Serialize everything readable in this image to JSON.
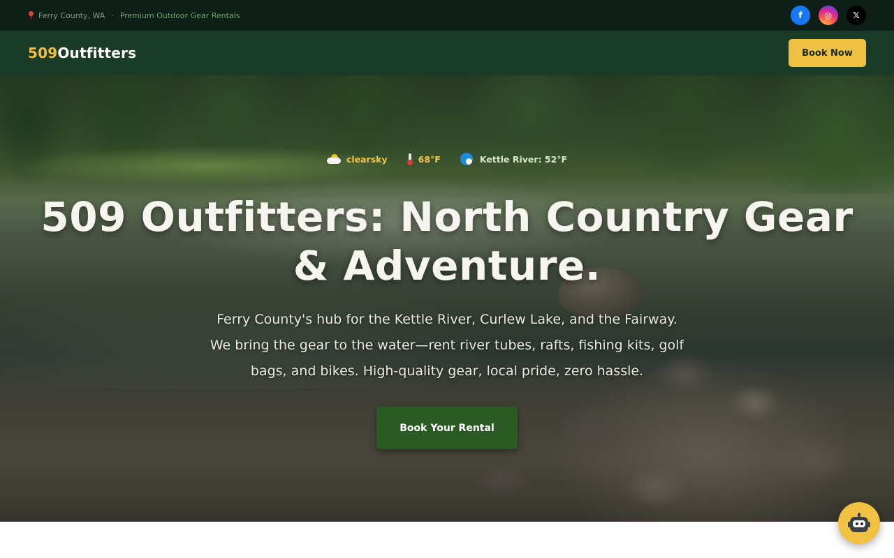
{
  "topbar": {
    "location": "Ferry County, WA",
    "separator": "·",
    "tagline": "Premium Outdoor Gear Rentals",
    "socials": [
      {
        "name": "facebook",
        "glyph": "f"
      },
      {
        "name": "instagram",
        "glyph": "◎"
      },
      {
        "name": "x",
        "glyph": "𝕏"
      }
    ]
  },
  "nav": {
    "logo_num": "509",
    "logo_word": "Outfitters",
    "book_now_label": "Book Now"
  },
  "weather": {
    "sky": "clearsky",
    "temp": "68°F",
    "river": "Kettle River: 52°F"
  },
  "hero": {
    "headline": "509 Outfitters: North Country Gear & Adventure.",
    "subtext": "Ferry County's hub for the Kettle River, Curlew Lake, and the Fairway. We bring the gear to the water—rent river tubes, rafts, fishing kits, golf bags, and bikes. High-quality gear, local pride, zero hassle.",
    "cta_label": "Book Your Rental"
  },
  "colors": {
    "topbar_bg": "#0d1f16",
    "nav_bg": "#1a3b27",
    "accent": "#efc143",
    "cta_bg": "#2b5a25"
  },
  "icons": [
    "pin-icon",
    "facebook-icon",
    "instagram-icon",
    "x-icon",
    "cloud-sun-icon",
    "thermometer-icon",
    "wave-icon",
    "robot-icon"
  ]
}
